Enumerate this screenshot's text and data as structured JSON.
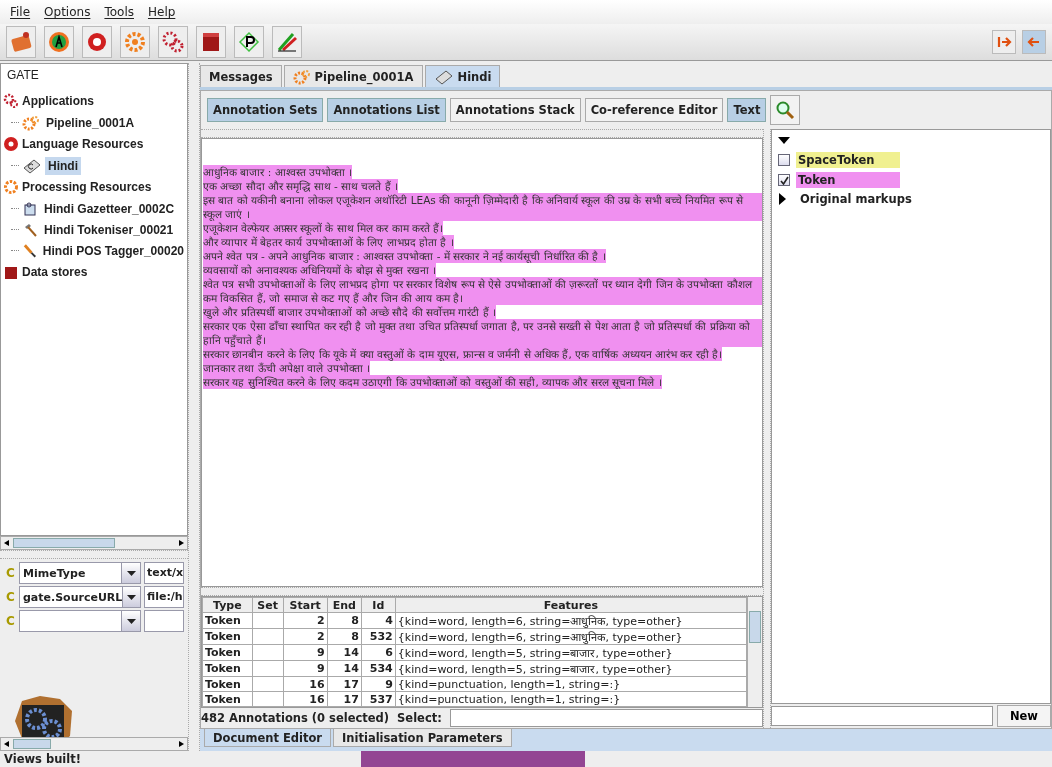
{
  "menu": [
    "File",
    "Options",
    "Tools",
    "Help"
  ],
  "toolbar": [
    {
      "kind": "open-app"
    },
    {
      "kind": "annie"
    },
    {
      "kind": "new-lr"
    },
    {
      "kind": "new-pr"
    },
    {
      "kind": "plugins"
    },
    {
      "kind": "datastore"
    },
    {
      "kind": "prolog"
    },
    {
      "kind": "edit"
    }
  ],
  "toolbar_right": [
    {
      "kind": "arrow-out",
      "selected": false
    },
    {
      "kind": "arrow-in",
      "selected": true
    }
  ],
  "tree": {
    "root": "GATE",
    "children": [
      {
        "label": "Applications",
        "kind": "applications",
        "selected": false,
        "children": [
          {
            "label": "Pipeline_0001A",
            "kind": "pipeline",
            "selected": false
          }
        ]
      },
      {
        "label": "Language Resources",
        "kind": "language",
        "selected": false,
        "children": [
          {
            "label": "Hindi",
            "kind": "document",
            "selected": true
          }
        ]
      },
      {
        "label": "Processing Resources",
        "kind": "processing",
        "selected": false,
        "children": [
          {
            "label": "Hindi Gazetteer_0002C",
            "kind": "gazetteer",
            "selected": false
          },
          {
            "label": "Hindi Tokeniser_00021",
            "kind": "tokeniser",
            "selected": false
          },
          {
            "label": "Hindi POS Tagger_00020",
            "kind": "tagger",
            "selected": false
          }
        ]
      },
      {
        "label": "Data stores",
        "kind": "datastore",
        "selected": false
      }
    ]
  },
  "features": [
    {
      "flag": "C",
      "name": "MimeType",
      "value": "text/x"
    },
    {
      "flag": "C",
      "name": "gate.SourceURL",
      "value": "file:/h"
    },
    {
      "flag": "C"
    }
  ],
  "tabs": [
    {
      "label": "Messages",
      "kind": "plain",
      "selected": false
    },
    {
      "label": "Pipeline_0001A",
      "kind": "pipeline",
      "selected": false
    },
    {
      "label": "Hindi",
      "kind": "document",
      "selected": true
    }
  ],
  "view_buttons": [
    {
      "label": "Annotation Sets",
      "selected": true
    },
    {
      "label": "Annotations List",
      "selected": true
    },
    {
      "label": "Annotations Stack",
      "selected": false
    },
    {
      "label": "Co-reference Editor",
      "selected": false
    },
    {
      "label": "Text",
      "selected": true
    }
  ],
  "document_lines": [
    "आधुनिक बाजार : आश्वस्त उपभोक्ता ।",
    "एक अच्छा सौदा और समृद्धि साथ - साथ चलते हैं ।",
    "इस बात को यकीनी बनाना लोकल एजूकेशन अथॉरिटी LEAs की कानूनी ज़िम्मेदारी है कि अनिवार्य स्कूल की उम्र के सभी बच्चे नियमित रूप से स्कूल जाएं ।",
    "एजूकेशन वेल्फेयर अफ़्सर स्कूलों के साथ मिल कर काम करते हैं।",
    "और व्यापार में बेहतर कार्य उपभोक्ताओं के लिए लाभप्रद होता है ।",
    "अपने श्वेत पत्र - अपने आधुनिक बाजार : आश्वस्त उपभोक्ता - में सरकार ने नई कार्यसूची निर्धारित की है ।",
    "व्यवसायों को अनावश्यक अधिनियमों के बोझ से मुक्त रखना ।",
    "श्वेत पत्र सभी उपभोक्ताओं के लिए लाभप्रद होगा पर सरकार विशेष रूप से ऐसे उपभोक्ताओं की ज़रूरतों पर ध्यान देगी जिन के उपभोक्ता कौशल कम विकसित हैं, जो समाज से कट गए हैं और जिन की आय कम है।",
    "खुले और प्रतिस्पर्धी बाजार उपभोक्ताओं को अच्छे सौदे की सर्वोत्तम गारंटी हैं ।",
    "सरकार एक ऐसा ढाँचा स्थापित कर रही है जो मुक्त तथा उचित प्रतिस्पर्धा जगाता है, पर उनसे सख्ती से पेश आता है जो प्रतिस्पर्धा की प्रक्रिया को हानि पहुँचाते हैं।",
    "सरकार छानबीन करने के लिए कि यूके में क्या वस्तुओं के दाम यूएस, फ्रान्स व जर्मनी से अधिक हैं, एक वार्षिक अध्ययन आरंभ कर रही है।",
    "जानकार तथा ऊँची अपेक्षा वाले उपभोक्ता ।",
    "सरकार यह सुनिश्चित करने के लिए कदम उठाएगी कि उपभोक्ताओं को वस्तुओं की सही, व्यापक और सरल सूचना मिले ।"
  ],
  "annotation_sets": {
    "expanded": true,
    "types": [
      {
        "label": "SpaceToken",
        "color": "#f0f090",
        "checked": false
      },
      {
        "label": "Token",
        "color": "#f090f0",
        "checked": true
      }
    ],
    "other_sets": [
      {
        "label": "Original markups",
        "expanded": false
      }
    ]
  },
  "new_button": "New",
  "table": {
    "columns": [
      "Type",
      "Set",
      "Start",
      "End",
      "Id",
      "Features"
    ],
    "rows": [
      [
        "Token",
        "",
        "2",
        "8",
        "4",
        "{kind=word, length=6, string=आधुनिक, type=other}"
      ],
      [
        "Token",
        "",
        "2",
        "8",
        "532",
        "{kind=word, length=6, string=आधुनिक, type=other}"
      ],
      [
        "Token",
        "",
        "9",
        "14",
        "6",
        "{kind=word, length=5, string=बाजार, type=other}"
      ],
      [
        "Token",
        "",
        "9",
        "14",
        "534",
        "{kind=word, length=5, string=बाजार, type=other}"
      ],
      [
        "Token",
        "",
        "16",
        "17",
        "9",
        "{kind=punctuation, length=1, string=:}"
      ],
      [
        "Token",
        "",
        "16",
        "17",
        "537",
        "{kind=punctuation, length=1, string=:}"
      ]
    ]
  },
  "annotation_count": "482 Annotations (0 selected)",
  "select_label": "Select:",
  "bottom_tabs": [
    {
      "label": "Document Editor",
      "selected": true
    },
    {
      "label": "Initialisation Parameters",
      "selected": false
    }
  ],
  "status": "Views built!"
}
